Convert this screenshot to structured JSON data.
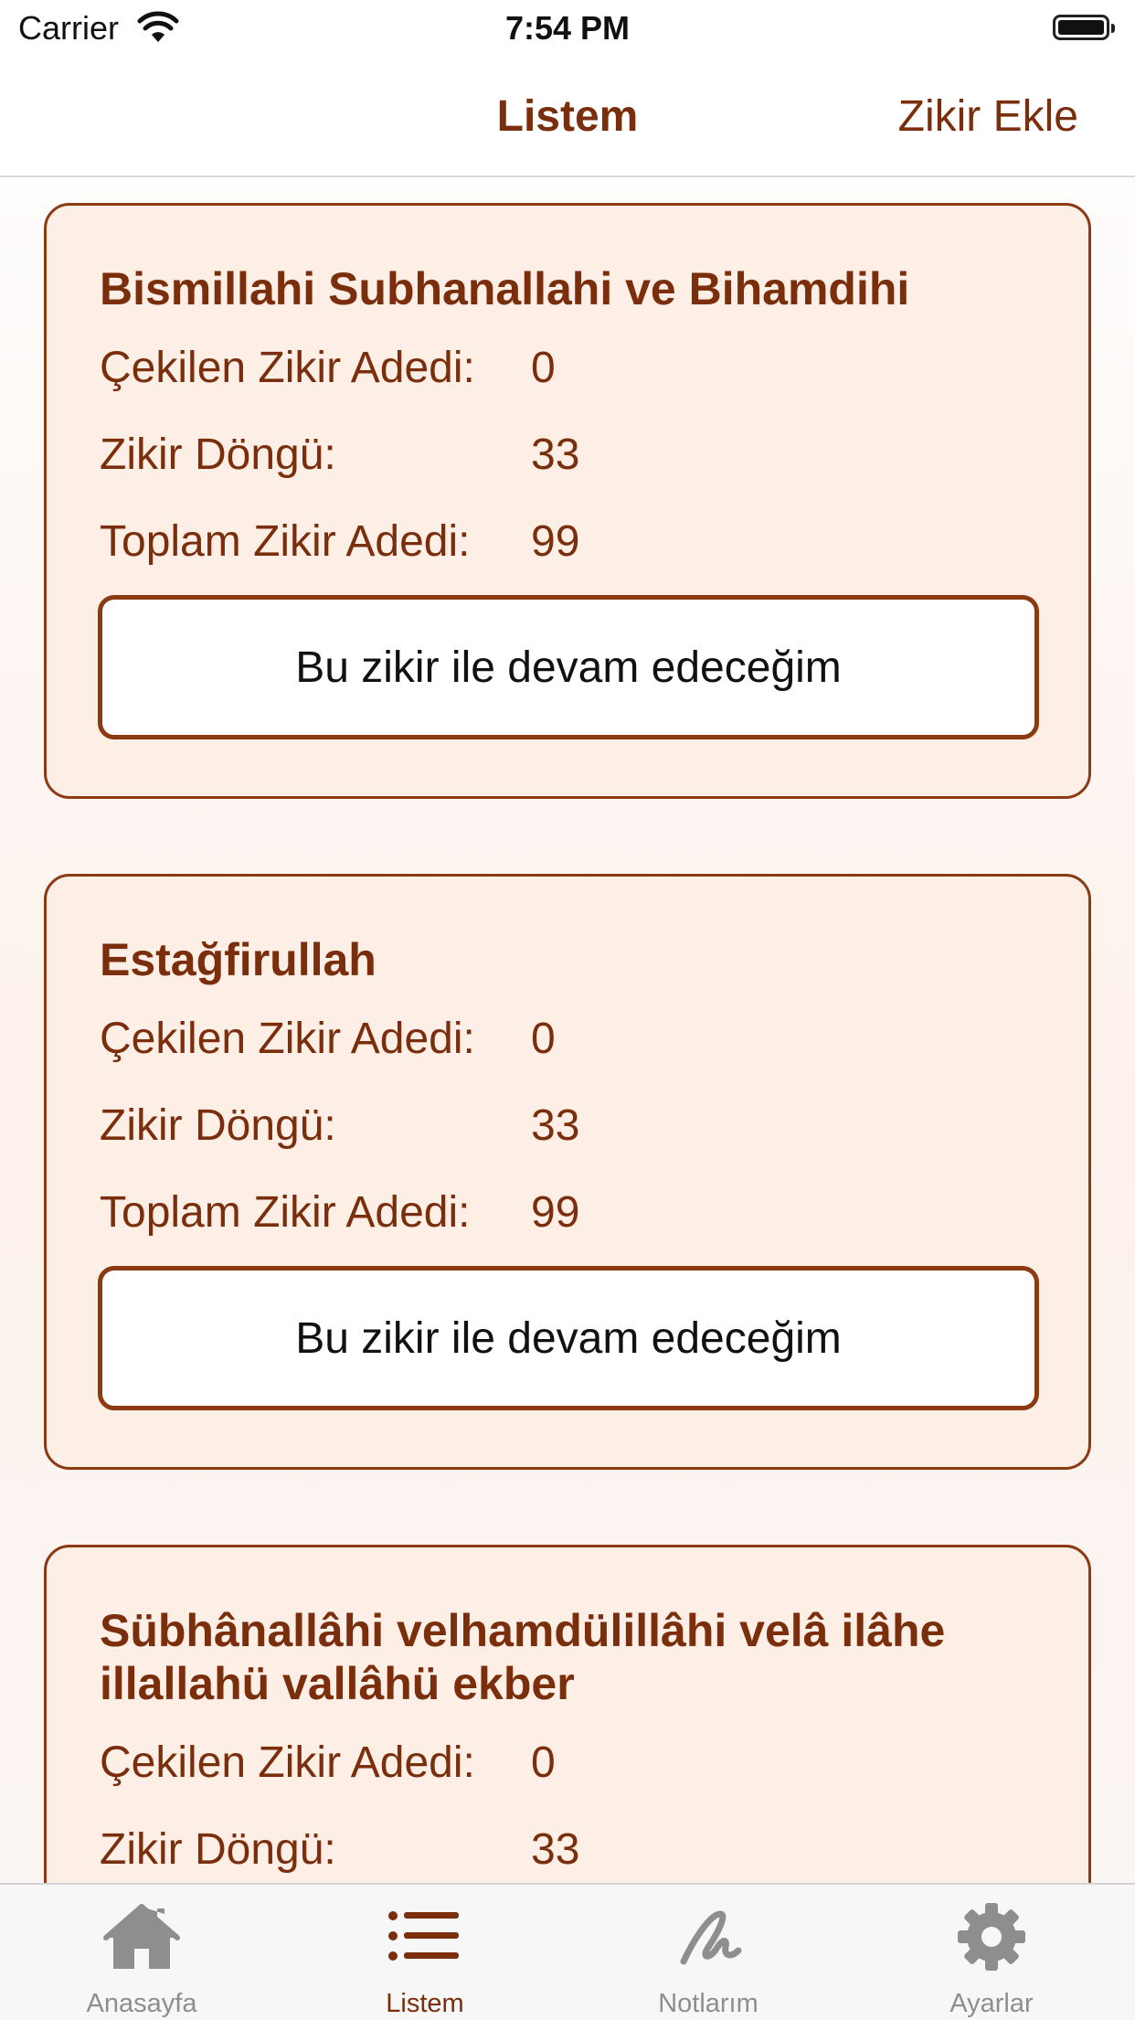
{
  "status_bar": {
    "carrier": "Carrier",
    "time": "7:54 PM"
  },
  "navbar": {
    "title": "Listem",
    "add_label": "Zikir Ekle"
  },
  "labels": {
    "count": "Çekilen Zikir Adedi:",
    "cycle": "Zikir Döngü:",
    "total": "Toplam Zikir Adedi:"
  },
  "cards": [
    {
      "title": "Bismillahi Subhanallahi ve Bihamdihi",
      "count": "0",
      "cycle": "33",
      "total": "99",
      "button": "Bu zikir ile devam edeceğim"
    },
    {
      "title": "Estağfirullah",
      "count": "0",
      "cycle": "33",
      "total": "99",
      "button": "Bu zikir ile devam edeceğim"
    },
    {
      "title": "Sübhânallâhi velhamdülillâhi velâ ilâhe illallahü vallâhü ekber",
      "count": "0",
      "cycle": "33"
    }
  ],
  "tabs": [
    {
      "label": "Anasayfa",
      "icon": "home-icon",
      "active": false
    },
    {
      "label": "Listem",
      "icon": "list-icon",
      "active": true
    },
    {
      "label": "Notlarım",
      "icon": "scribble-icon",
      "active": false
    },
    {
      "label": "Ayarlar",
      "icon": "gear-icon",
      "active": false
    }
  ],
  "colors": {
    "accent": "#7a2e0c",
    "card_bg": "#fdeee6",
    "inactive": "#8e8e8e"
  }
}
